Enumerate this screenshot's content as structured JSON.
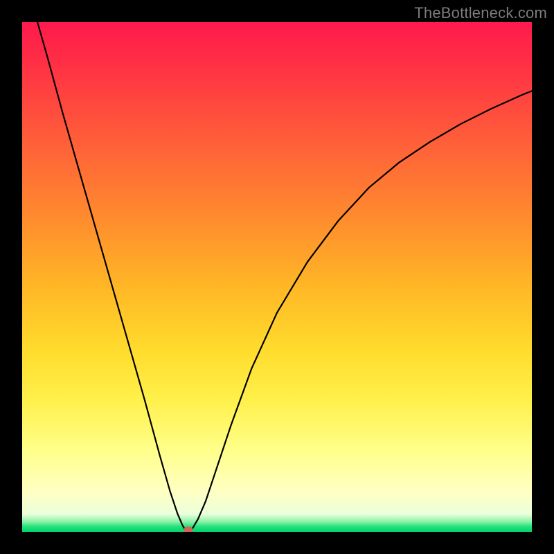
{
  "watermark": "TheBottleneck.com",
  "chart_data": {
    "type": "line",
    "title": "",
    "xlabel": "",
    "ylabel": "",
    "xlim": [
      0,
      100
    ],
    "ylim": [
      0,
      100
    ],
    "grid": false,
    "legend": false,
    "series": [
      {
        "name": "left-branch",
        "x": [
          3,
          5,
          8,
          12,
          16,
          20,
          24,
          27,
          29,
          30.5,
          31.5,
          32,
          32.3,
          32.5
        ],
        "y": [
          100,
          93,
          82,
          68,
          54,
          40,
          26,
          15,
          8,
          3.5,
          1.2,
          0.4,
          0.1,
          0
        ]
      },
      {
        "name": "right-branch",
        "x": [
          32.7,
          33,
          33.5,
          34.5,
          36,
          38,
          41,
          45,
          50,
          56,
          62,
          68,
          74,
          80,
          86,
          92,
          98,
          100
        ],
        "y": [
          0,
          0.2,
          0.8,
          2.5,
          6,
          12,
          21,
          32,
          43,
          53,
          61,
          67.5,
          72.5,
          76.5,
          80,
          83,
          85.7,
          86.5
        ]
      }
    ],
    "marker": {
      "x": 32.6,
      "y": 0.4,
      "color": "#d4635a"
    },
    "curve_color": "#000000",
    "curve_width": 2.2
  }
}
